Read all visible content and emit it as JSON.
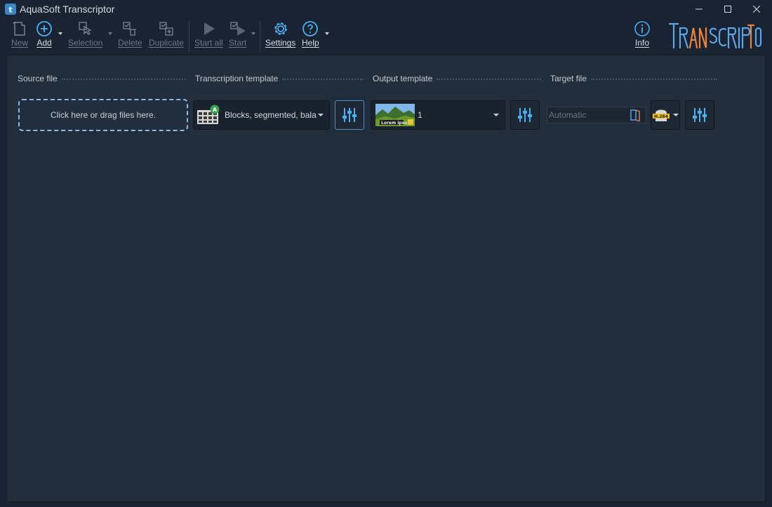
{
  "window": {
    "title": "AquaSoft Transcriptor"
  },
  "toolbar": {
    "new": "New",
    "add": "Add",
    "selection": "Selection",
    "delete": "Delete",
    "duplicate": "Duplicate",
    "start_all": "Start all",
    "start": "Start",
    "settings": "Settings",
    "help": "Help",
    "info": "Info"
  },
  "logo": {
    "text": "TRANSCRIPTOR",
    "colors": [
      "#5aa6e8",
      "#e9843a"
    ]
  },
  "columns": {
    "source": "Source file",
    "transcription": "Transcription template",
    "output": "Output template",
    "target": "Target file"
  },
  "row": {
    "dropzone": "Click here or drag files here.",
    "transcription_value": "Blocks, segmented, balanced",
    "transcription_badge": "A",
    "output_value": "1",
    "output_thumb_text": "Lorem ipsum",
    "target_placeholder": "Automatic",
    "codec_badge": "H.264"
  },
  "colors": {
    "accent": "#4ab0f0",
    "background": "#1a2332",
    "panel": "#232e3d"
  }
}
